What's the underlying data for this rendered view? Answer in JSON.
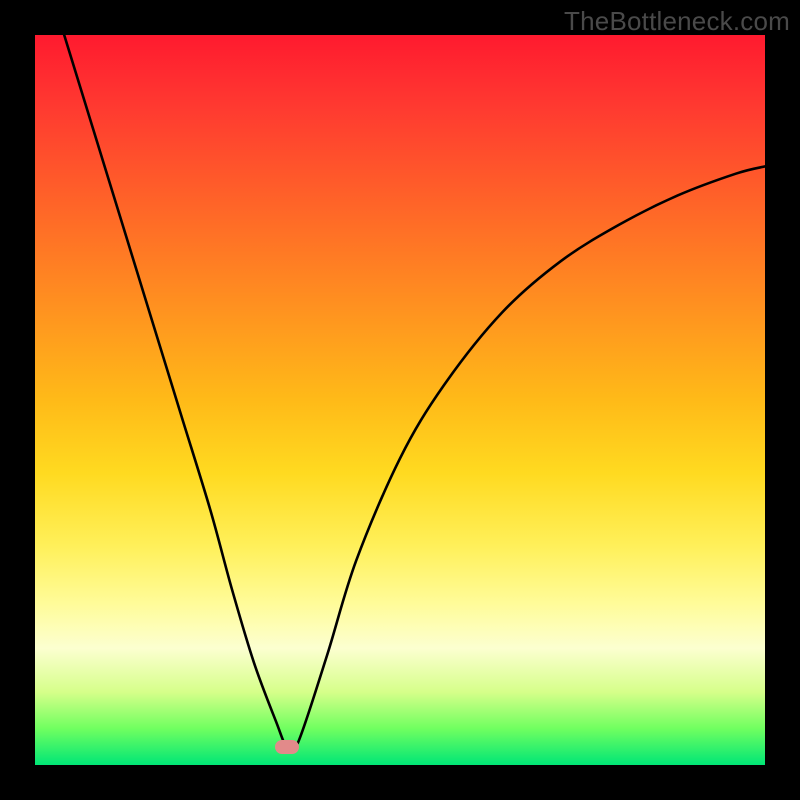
{
  "watermark": "TheBottleneck.com",
  "chart_data": {
    "type": "line",
    "title": "",
    "xlabel": "",
    "ylabel": "",
    "xlim": [
      0,
      100
    ],
    "ylim": [
      0,
      100
    ],
    "series": [
      {
        "name": "curve",
        "x": [
          4,
          8,
          12,
          16,
          20,
          24,
          27,
          30,
          33,
          34.5,
          36,
          40,
          44,
          50,
          56,
          64,
          72,
          80,
          88,
          96,
          100
        ],
        "y": [
          100,
          87,
          74,
          61,
          48,
          35,
          24,
          14,
          6,
          2.5,
          3,
          15,
          28,
          42,
          52,
          62,
          69,
          74,
          78,
          81,
          82
        ]
      }
    ],
    "marker": {
      "x": 34.5,
      "y": 2.5
    },
    "background_gradient": {
      "top": "#ff1a2f",
      "bottom": "#00e676"
    }
  }
}
